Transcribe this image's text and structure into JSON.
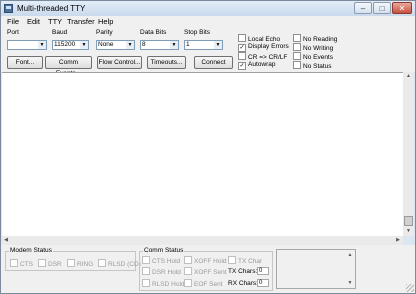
{
  "window": {
    "title": "Multi-threaded TTY",
    "minimize": "–",
    "maximize": "□",
    "close": "✕"
  },
  "menu": [
    "File",
    "Edit",
    "TTY",
    "Transfer",
    "Help"
  ],
  "settings": {
    "port": {
      "label": "Port",
      "value": ""
    },
    "baud": {
      "label": "Baud",
      "value": "115200"
    },
    "parity": {
      "label": "Parity",
      "value": "None"
    },
    "data_bits": {
      "label": "Data Bits",
      "value": "8"
    },
    "stop_bits": {
      "label": "Stop Bits",
      "value": "1"
    }
  },
  "buttons": {
    "font": "Font...",
    "comm_events": "Comm Events...",
    "flow_control": "Flow Control...",
    "timeouts": "Timeouts...",
    "connect": "Connect"
  },
  "options_left": [
    {
      "label": "Local Echo",
      "checked": false
    },
    {
      "label": "Display Errors",
      "checked": true
    },
    {
      "label": "CR => CR/LF",
      "checked": false
    },
    {
      "label": "Autowrap",
      "checked": true
    }
  ],
  "options_right": [
    {
      "label": "No Reading",
      "checked": false
    },
    {
      "label": "No Writing",
      "checked": false
    },
    {
      "label": "No Events",
      "checked": false
    },
    {
      "label": "No Status",
      "checked": false
    }
  ],
  "modem_status": {
    "title": "Modem Status",
    "items": [
      "CTS",
      "DSR",
      "RING",
      "RLSD (CD)"
    ]
  },
  "comm_status": {
    "title": "Comm Status",
    "col1": [
      "CTS Hold",
      "DSR Hold",
      "RLSD Hold"
    ],
    "col2": [
      "XOFF Hold",
      "XOFF Sent",
      "EOF Sent"
    ],
    "tx_char": "TX Char",
    "tx_chars_label": "TX Chars:",
    "tx_chars_value": "0",
    "rx_chars_label": "RX Chars:",
    "rx_chars_value": "0"
  }
}
